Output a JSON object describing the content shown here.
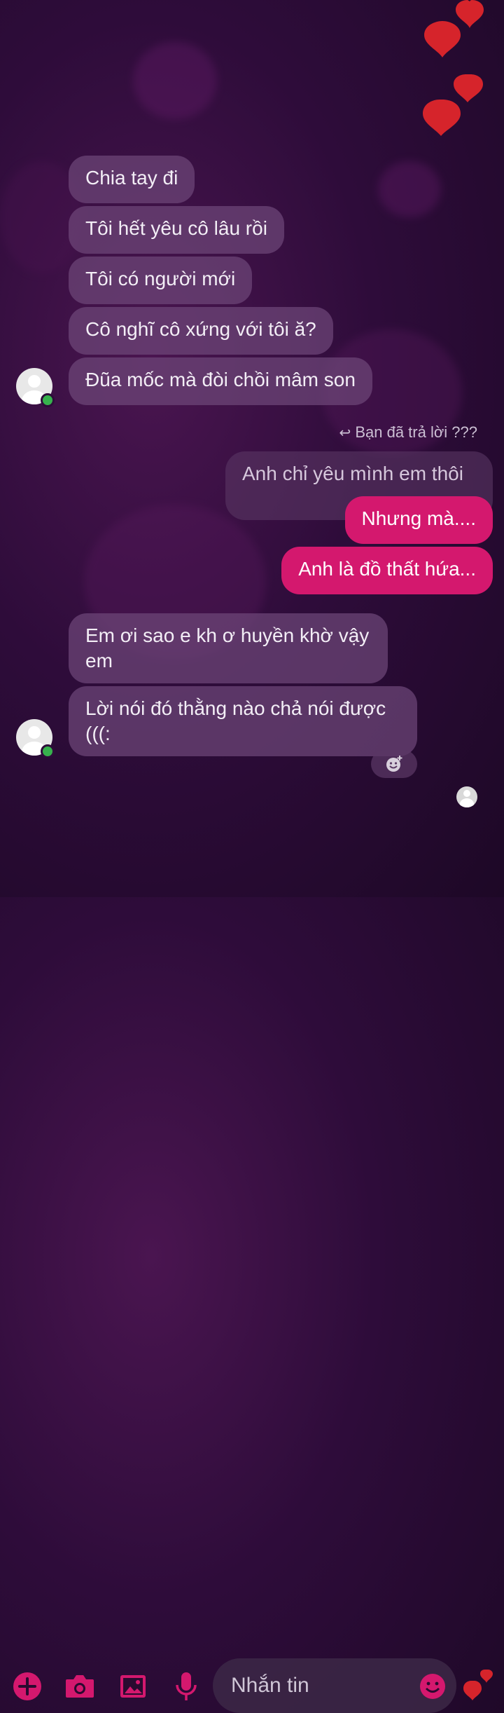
{
  "messages_received_1": [
    {
      "text": "Chia tay đi"
    },
    {
      "text": "Tôi hết yêu cô lâu rồi"
    },
    {
      "text": "Tôi có người mới"
    },
    {
      "text": "Cô nghĩ cô xứng với tôi ă?"
    },
    {
      "text": "Đũa mốc mà đòi chồi mâm son"
    }
  ],
  "reply_note": "Bạn đã trả lời ???",
  "replied_message": "Anh chỉ yêu mình em thôi",
  "messages_sent": [
    {
      "text": "Nhưng mà...."
    },
    {
      "text": "Anh là đồ thất hứa..."
    }
  ],
  "messages_received_2": [
    {
      "text": "Em ơi sao e kh ơ huyền khờ vậy\nem"
    },
    {
      "text": "Lời nói đó thằng nào chả nói được\n(((:"
    }
  ],
  "composer": {
    "placeholder": "Nhắn tin"
  },
  "icons": {
    "add": "plus-icon",
    "camera": "camera-icon",
    "gallery": "image-icon",
    "voice": "microphone-icon",
    "emoji": "emoji-icon",
    "like": "heart-icon"
  },
  "colors": {
    "accent": "#d4186e",
    "bubble_in": "#6e4678",
    "background": "#2e0c3a"
  }
}
